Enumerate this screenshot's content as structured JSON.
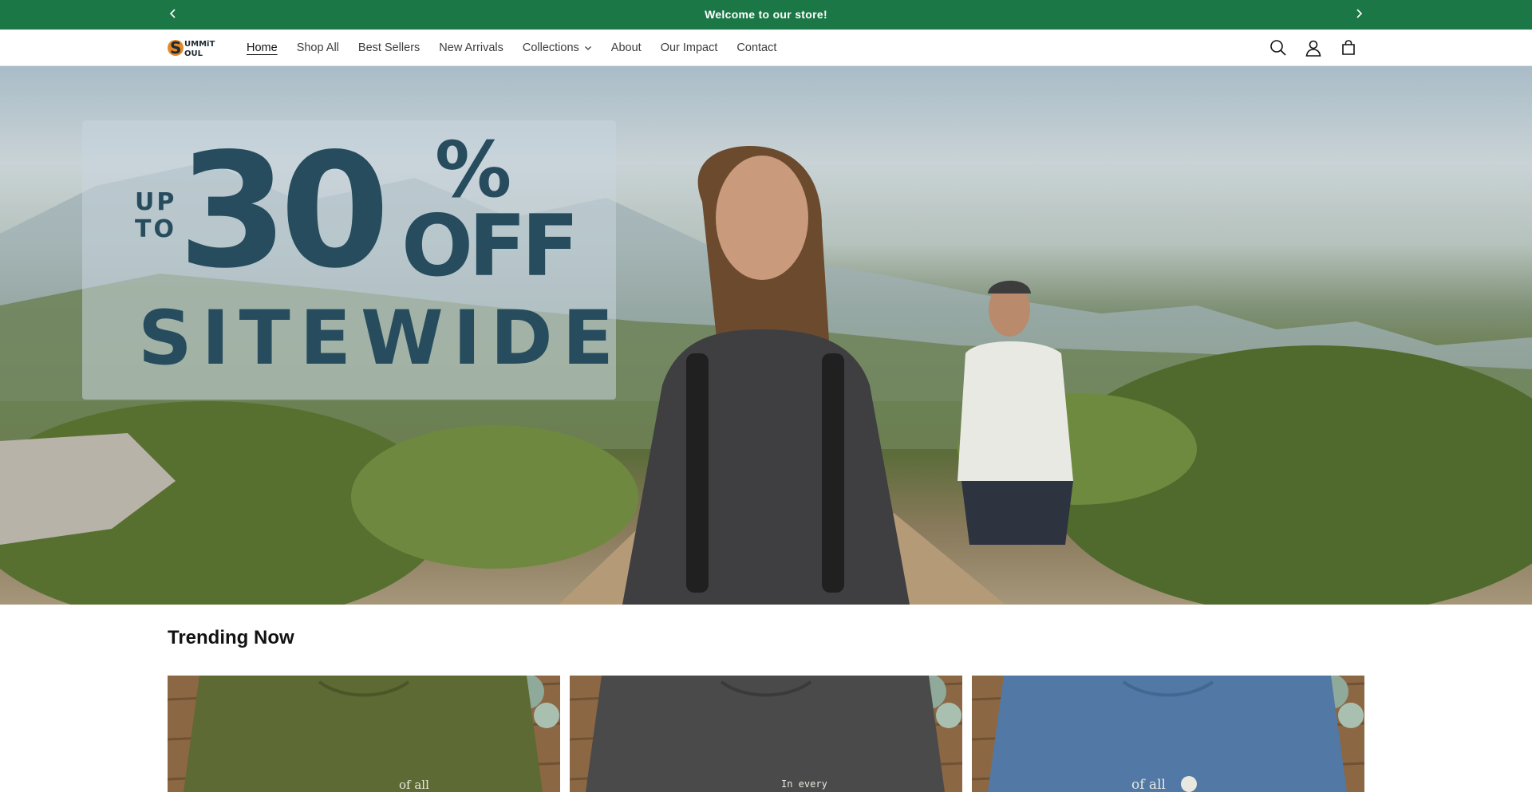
{
  "announcement": {
    "message": "Welcome to our store!",
    "prev_icon": "chevron-left-icon",
    "next_icon": "chevron-right-icon"
  },
  "header": {
    "logo_text_line1": "UMMiT",
    "logo_text_line2": "OUL",
    "logo_initial": "S",
    "nav": [
      {
        "label": "Home",
        "active": true
      },
      {
        "label": "Shop All"
      },
      {
        "label": "Best Sellers"
      },
      {
        "label": "New Arrivals"
      },
      {
        "label": "Collections",
        "has_dropdown": true
      },
      {
        "label": "About"
      },
      {
        "label": "Our Impact"
      },
      {
        "label": "Contact"
      }
    ],
    "icons": [
      "search-icon",
      "account-icon",
      "cart-icon"
    ]
  },
  "hero": {
    "promo_upto": "UP TO",
    "promo_up": "UP",
    "promo_to": "TO",
    "promo_number": "30",
    "promo_percent": "%",
    "promo_off": "OFF",
    "promo_sitewide": "SITEWIDE",
    "promo_color": "#264c5e"
  },
  "trending": {
    "title": "Trending Now",
    "products": [
      {
        "shirt_color": "#5d6a33",
        "print_text": "of all"
      },
      {
        "shirt_color": "#4a4a4a",
        "print_text": "In every"
      },
      {
        "shirt_color": "#5279a6",
        "print_text": "of all"
      }
    ]
  },
  "colors": {
    "announcement_bg": "#1c7746",
    "header_bg": "#ffffff",
    "text": "#121212"
  }
}
